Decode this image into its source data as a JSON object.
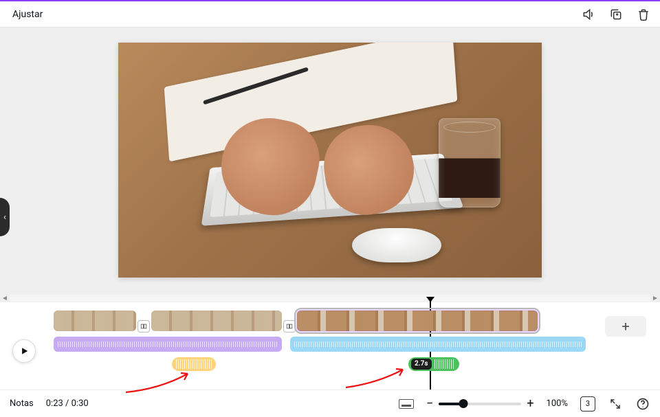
{
  "topbar": {
    "title": "Ajustar"
  },
  "timeline": {
    "playhead_seconds": 23,
    "sfx_green_badge": "2.7s"
  },
  "footer": {
    "notes_label": "Notas",
    "time_display": "0:23 / 0:30",
    "zoom_percent_label": "100%",
    "page_count": "3"
  }
}
